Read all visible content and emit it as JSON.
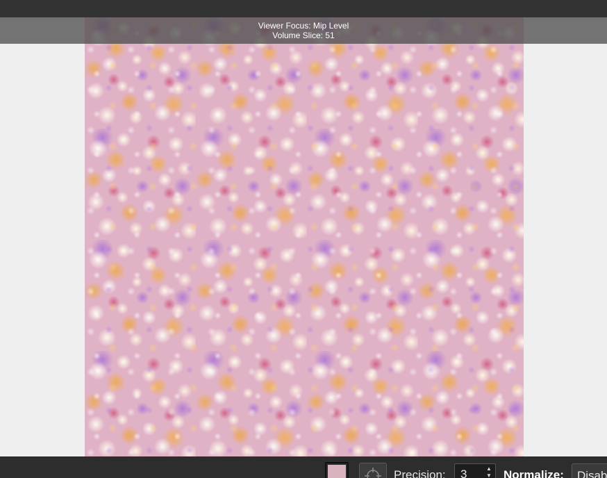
{
  "viewer": {
    "focus_text": "Viewer Focus: Mip Level",
    "slice_text": "Volume Slice: 51"
  },
  "toolbar": {
    "swatch_color": "#d8b4bf",
    "pick_icon": "crosshair-icon",
    "precision_label": "Precision:",
    "precision_value": "3",
    "normalize_label": "Normalize:",
    "normalize_value": "Disab"
  },
  "colors": {
    "top_bar": "#333333",
    "bottom_bar": "#2d2d2d",
    "background": "#efefef"
  }
}
